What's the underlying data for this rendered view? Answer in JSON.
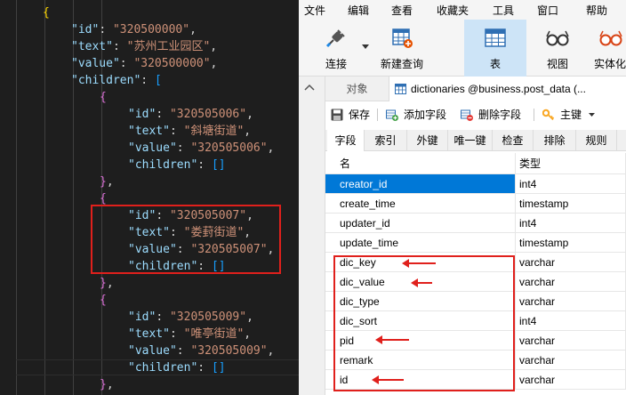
{
  "editor": {
    "lines": [
      {
        "indent": 1,
        "parts": [
          {
            "t": "{",
            "c": "tok-brace-yellow"
          }
        ]
      },
      {
        "indent": 2,
        "parts": [
          {
            "t": "\"id\"",
            "c": "tok-key"
          },
          {
            "t": ": ",
            "c": "tok-punc"
          },
          {
            "t": "\"320500000\"",
            "c": "tok-str"
          },
          {
            "t": ",",
            "c": "tok-punc"
          }
        ]
      },
      {
        "indent": 2,
        "parts": [
          {
            "t": "\"text\"",
            "c": "tok-key"
          },
          {
            "t": ": ",
            "c": "tok-punc"
          },
          {
            "t": "\"苏州工业园区\"",
            "c": "tok-str"
          },
          {
            "t": ",",
            "c": "tok-punc"
          }
        ]
      },
      {
        "indent": 2,
        "parts": [
          {
            "t": "\"value\"",
            "c": "tok-key"
          },
          {
            "t": ": ",
            "c": "tok-punc"
          },
          {
            "t": "\"320500000\"",
            "c": "tok-str"
          },
          {
            "t": ",",
            "c": "tok-punc"
          }
        ]
      },
      {
        "indent": 2,
        "parts": [
          {
            "t": "\"children\"",
            "c": "tok-key"
          },
          {
            "t": ": ",
            "c": "tok-punc"
          },
          {
            "t": "[",
            "c": "tok-bracket"
          }
        ]
      },
      {
        "indent": 3,
        "parts": [
          {
            "t": "{",
            "c": "tok-brace-magenta"
          }
        ]
      },
      {
        "indent": 4,
        "parts": [
          {
            "t": "\"id\"",
            "c": "tok-key"
          },
          {
            "t": ": ",
            "c": "tok-punc"
          },
          {
            "t": "\"320505006\"",
            "c": "tok-str"
          },
          {
            "t": ",",
            "c": "tok-punc"
          }
        ]
      },
      {
        "indent": 4,
        "parts": [
          {
            "t": "\"text\"",
            "c": "tok-key"
          },
          {
            "t": ": ",
            "c": "tok-punc"
          },
          {
            "t": "\"斜塘街道\"",
            "c": "tok-str"
          },
          {
            "t": ",",
            "c": "tok-punc"
          }
        ]
      },
      {
        "indent": 4,
        "parts": [
          {
            "t": "\"value\"",
            "c": "tok-key"
          },
          {
            "t": ": ",
            "c": "tok-punc"
          },
          {
            "t": "\"320505006\"",
            "c": "tok-str"
          },
          {
            "t": ",",
            "c": "tok-punc"
          }
        ]
      },
      {
        "indent": 4,
        "parts": [
          {
            "t": "\"children\"",
            "c": "tok-key"
          },
          {
            "t": ": ",
            "c": "tok-punc"
          },
          {
            "t": "[]",
            "c": "tok-bracket"
          }
        ]
      },
      {
        "indent": 3,
        "parts": [
          {
            "t": "}",
            "c": "tok-brace-magenta"
          },
          {
            "t": ",",
            "c": "tok-punc"
          }
        ]
      },
      {
        "indent": 3,
        "parts": [
          {
            "t": "{",
            "c": "tok-brace-magenta"
          }
        ]
      },
      {
        "indent": 4,
        "parts": [
          {
            "t": "\"id\"",
            "c": "tok-key"
          },
          {
            "t": ": ",
            "c": "tok-punc"
          },
          {
            "t": "\"320505007\"",
            "c": "tok-str"
          },
          {
            "t": ",",
            "c": "tok-punc"
          }
        ]
      },
      {
        "indent": 4,
        "parts": [
          {
            "t": "\"text\"",
            "c": "tok-key"
          },
          {
            "t": ": ",
            "c": "tok-punc"
          },
          {
            "t": "\"娄葑街道\"",
            "c": "tok-str"
          },
          {
            "t": ",",
            "c": "tok-punc"
          }
        ]
      },
      {
        "indent": 4,
        "parts": [
          {
            "t": "\"value\"",
            "c": "tok-key"
          },
          {
            "t": ": ",
            "c": "tok-punc"
          },
          {
            "t": "\"320505007\"",
            "c": "tok-str"
          },
          {
            "t": ",",
            "c": "tok-punc"
          }
        ]
      },
      {
        "indent": 4,
        "parts": [
          {
            "t": "\"children\"",
            "c": "tok-key"
          },
          {
            "t": ": ",
            "c": "tok-punc"
          },
          {
            "t": "[]",
            "c": "tok-bracket"
          }
        ]
      },
      {
        "indent": 3,
        "parts": [
          {
            "t": "}",
            "c": "tok-brace-magenta"
          },
          {
            "t": ",",
            "c": "tok-punc"
          }
        ]
      },
      {
        "indent": 3,
        "parts": [
          {
            "t": "{",
            "c": "tok-brace-magenta"
          }
        ]
      },
      {
        "indent": 4,
        "parts": [
          {
            "t": "\"id\"",
            "c": "tok-key"
          },
          {
            "t": ": ",
            "c": "tok-punc"
          },
          {
            "t": "\"320505009\"",
            "c": "tok-str"
          },
          {
            "t": ",",
            "c": "tok-punc"
          }
        ]
      },
      {
        "indent": 4,
        "parts": [
          {
            "t": "\"text\"",
            "c": "tok-key"
          },
          {
            "t": ": ",
            "c": "tok-punc"
          },
          {
            "t": "\"唯亭街道\"",
            "c": "tok-str"
          },
          {
            "t": ",",
            "c": "tok-punc"
          }
        ]
      },
      {
        "indent": 4,
        "parts": [
          {
            "t": "\"value\"",
            "c": "tok-key"
          },
          {
            "t": ": ",
            "c": "tok-punc"
          },
          {
            "t": "\"320505009\"",
            "c": "tok-str"
          },
          {
            "t": ",",
            "c": "tok-punc"
          }
        ]
      },
      {
        "indent": 4,
        "parts": [
          {
            "t": "\"children\"",
            "c": "tok-key"
          },
          {
            "t": ": ",
            "c": "tok-punc"
          },
          {
            "t": "[]",
            "c": "tok-bracket"
          }
        ]
      },
      {
        "indent": 3,
        "parts": [
          {
            "t": "}",
            "c": "tok-brace-magenta"
          },
          {
            "t": ",",
            "c": "tok-punc"
          }
        ]
      }
    ]
  },
  "navicat": {
    "menu": [
      "文件",
      "编辑",
      "查看",
      "收藏夹",
      "工具",
      "窗口",
      "帮助"
    ],
    "toolbar": {
      "connect": "连接",
      "new_query": "新建查询",
      "table": "表",
      "view": "视图",
      "materialized_view": "实体化"
    },
    "tabs": {
      "objects": "对象",
      "active": "dictionaries @business.post_data (..."
    },
    "actions": {
      "save": "保存",
      "add_field": "添加字段",
      "delete_field": "删除字段",
      "primary_key": "主键"
    },
    "subtabs": [
      "字段",
      "索引",
      "外键",
      "唯一键",
      "检查",
      "排除",
      "规则"
    ],
    "grid": {
      "col_name": "名",
      "col_type": "类型",
      "rows": [
        {
          "name": "creator_id",
          "type": "int4"
        },
        {
          "name": "create_time",
          "type": "timestamp"
        },
        {
          "name": "updater_id",
          "type": "int4"
        },
        {
          "name": "update_time",
          "type": "timestamp"
        },
        {
          "name": "dic_key",
          "type": "varchar"
        },
        {
          "name": "dic_value",
          "type": "varchar"
        },
        {
          "name": "dic_type",
          "type": "varchar"
        },
        {
          "name": "dic_sort",
          "type": "int4"
        },
        {
          "name": "pid",
          "type": "varchar"
        },
        {
          "name": "remark",
          "type": "varchar"
        },
        {
          "name": "id",
          "type": "varchar"
        }
      ],
      "selected_row": "creator_id"
    },
    "colors": {
      "selection": "#0078d7",
      "annotation": "#e0201c"
    }
  }
}
